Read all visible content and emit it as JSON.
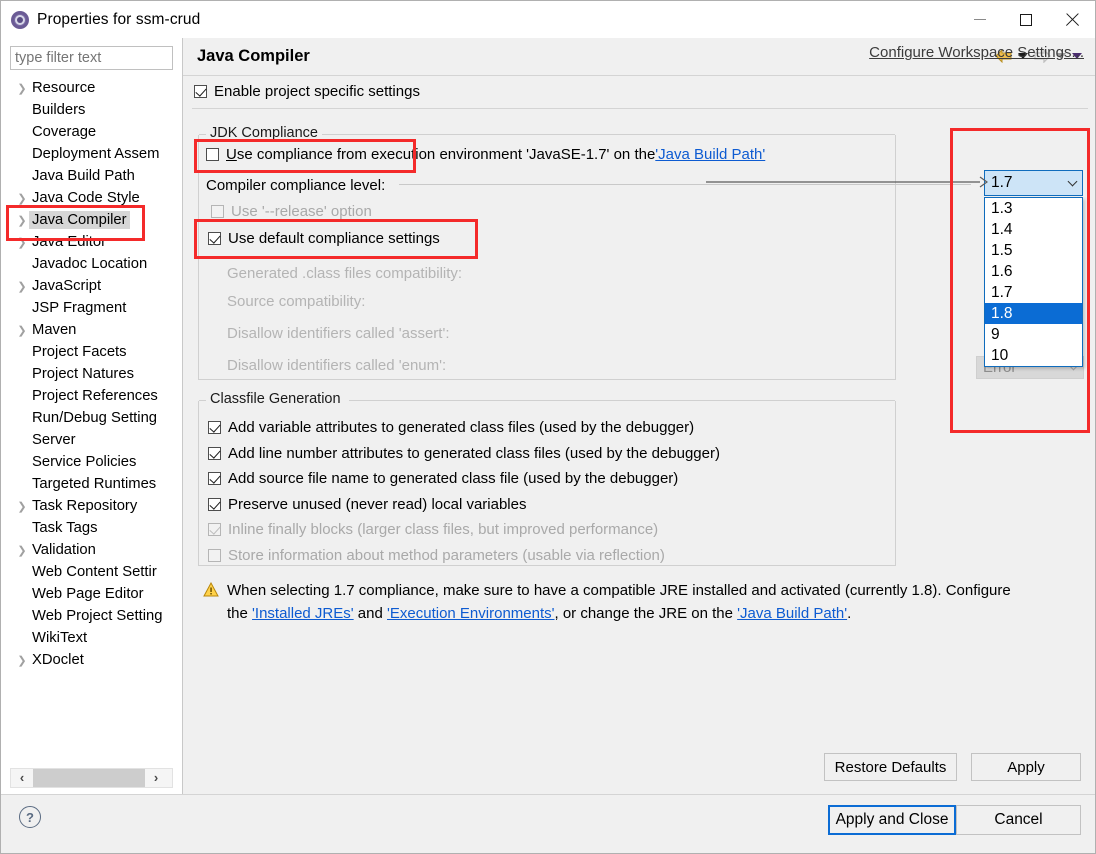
{
  "window": {
    "title": "Properties for ssm-crud",
    "icon": "eclipse-properties-icon",
    "minimize_label": "—",
    "maximize_label": "□",
    "close_label": "✕"
  },
  "sidebar": {
    "filter_placeholder": "type filter text",
    "filter_value": "",
    "scroll_left_label": "‹",
    "scroll_right_label": "›",
    "items": [
      {
        "label": "Resource",
        "expandable": true,
        "selected": false
      },
      {
        "label": "Builders",
        "expandable": false,
        "selected": false
      },
      {
        "label": "Coverage",
        "expandable": false,
        "selected": false
      },
      {
        "label": "Deployment Assem",
        "expandable": false,
        "selected": false
      },
      {
        "label": "Java Build Path",
        "expandable": false,
        "selected": false
      },
      {
        "label": "Java Code Style",
        "expandable": true,
        "selected": false
      },
      {
        "label": "Java Compiler",
        "expandable": true,
        "selected": true
      },
      {
        "label": "Java Editor",
        "expandable": true,
        "selected": false
      },
      {
        "label": "Javadoc Location",
        "expandable": false,
        "selected": false
      },
      {
        "label": "JavaScript",
        "expandable": true,
        "selected": false
      },
      {
        "label": "JSP Fragment",
        "expandable": false,
        "selected": false
      },
      {
        "label": "Maven",
        "expandable": true,
        "selected": false
      },
      {
        "label": "Project Facets",
        "expandable": false,
        "selected": false
      },
      {
        "label": "Project Natures",
        "expandable": false,
        "selected": false
      },
      {
        "label": "Project References",
        "expandable": false,
        "selected": false
      },
      {
        "label": "Run/Debug Setting",
        "expandable": false,
        "selected": false
      },
      {
        "label": "Server",
        "expandable": false,
        "selected": false
      },
      {
        "label": "Service Policies",
        "expandable": false,
        "selected": false
      },
      {
        "label": "Targeted Runtimes",
        "expandable": false,
        "selected": false
      },
      {
        "label": "Task Repository",
        "expandable": true,
        "selected": false
      },
      {
        "label": "Task Tags",
        "expandable": false,
        "selected": false
      },
      {
        "label": "Validation",
        "expandable": true,
        "selected": false
      },
      {
        "label": "Web Content Settir",
        "expandable": false,
        "selected": false
      },
      {
        "label": "Web Page Editor",
        "expandable": false,
        "selected": false
      },
      {
        "label": "Web Project Setting",
        "expandable": false,
        "selected": false
      },
      {
        "label": "WikiText",
        "expandable": false,
        "selected": false
      },
      {
        "label": "XDoclet",
        "expandable": true,
        "selected": false
      }
    ]
  },
  "page": {
    "title": "Java Compiler",
    "nav": {
      "back_icon": "back-arrow-icon",
      "back_menu_icon": "chevron-down-icon",
      "forward_icon": "forward-arrow-icon",
      "forward_menu_icon": "chevron-down-icon",
      "extra_menu_icon": "chevron-down-icon"
    },
    "enable_project_specific": {
      "label": "Enable project specific settings",
      "checked": true
    },
    "configure_workspace_link": "Configure Workspace Settings..."
  },
  "jdk_compliance": {
    "legend": "JDK Compliance",
    "use_execution_env": {
      "prefix": "Use compliance from execution environment 'JavaSE-1.7' on the ",
      "mnemonic": "U",
      "rest": "se compliance from execution environment 'JavaSE-1.7' on the ",
      "link": "'Java Build Path'",
      "checked": false
    },
    "compiler_compliance_level_label": "Compiler compliance level:",
    "compliance_combo": {
      "value": "1.7",
      "chevron_icon": "chevron-down-icon",
      "options": [
        "1.3",
        "1.4",
        "1.5",
        "1.6",
        "1.7",
        "1.8",
        "9",
        "10"
      ],
      "highlighted_option": "1.8",
      "expanded": true
    },
    "use_release_option": {
      "label": "Use '--release' option",
      "checked": false,
      "disabled": true
    },
    "use_default_compliance": {
      "label": "Use default compliance settings",
      "checked": true
    },
    "generated_class_files_compatibility": "Generated .class files compatibility:",
    "source_compatibility": "Source compatibility:",
    "disallow_assert": "Disallow identifiers called 'assert':",
    "disallow_enum": "Disallow identifiers called 'enum':",
    "disabled_combo_value": "Error"
  },
  "classfile_generation": {
    "legend": "Classfile Generation",
    "options": [
      {
        "label": "Add variable attributes to generated class files (used by the debugger)",
        "checked": true,
        "disabled": false
      },
      {
        "label": "Add line number attributes to generated class files (used by the debugger)",
        "checked": true,
        "disabled": false
      },
      {
        "label": "Add source file name to generated class file (used by the debugger)",
        "checked": true,
        "disabled": false
      },
      {
        "label": "Preserve unused (never read) local variables",
        "checked": true,
        "disabled": false
      },
      {
        "label": "Inline finally blocks (larger class files, but improved performance)",
        "checked": true,
        "disabled": true
      },
      {
        "label": "Store information about method parameters (usable via reflection)",
        "checked": false,
        "disabled": true
      }
    ]
  },
  "warning": {
    "icon": "warning-triangle-icon",
    "line1_a": "When selecting 1.7 compliance, make sure to have a compatible JRE installed and activated (currently 1.8). Configure",
    "line2_a": "the ",
    "link1": "'Installed JREs'",
    "line2_b": " and ",
    "link2": "'Execution Environments'",
    "line2_c": ", or change the JRE on the ",
    "link3": "'Java Build Path'",
    "line2_d": "."
  },
  "buttons": {
    "restore_defaults": "Restore Defaults",
    "apply": "Apply",
    "apply_and_close": "Apply and Close",
    "cancel": "Cancel",
    "help_icon": "help-question-icon"
  },
  "annotations": {
    "color": "#f42a2a",
    "boxes": [
      "sidebar-java-compiler",
      "use-compliance-from-execution-env",
      "use-default-compliance-settings",
      "compliance-dropdown"
    ],
    "arrow": "pointer-to-compliance-combo"
  },
  "colors": {
    "accent_blue": "#0b6cd4",
    "link_blue": "#0d5bd1",
    "annotation_red": "#f42a2a",
    "panel_bg": "#f0f0f0",
    "combo_bg": "#cde4f7"
  }
}
